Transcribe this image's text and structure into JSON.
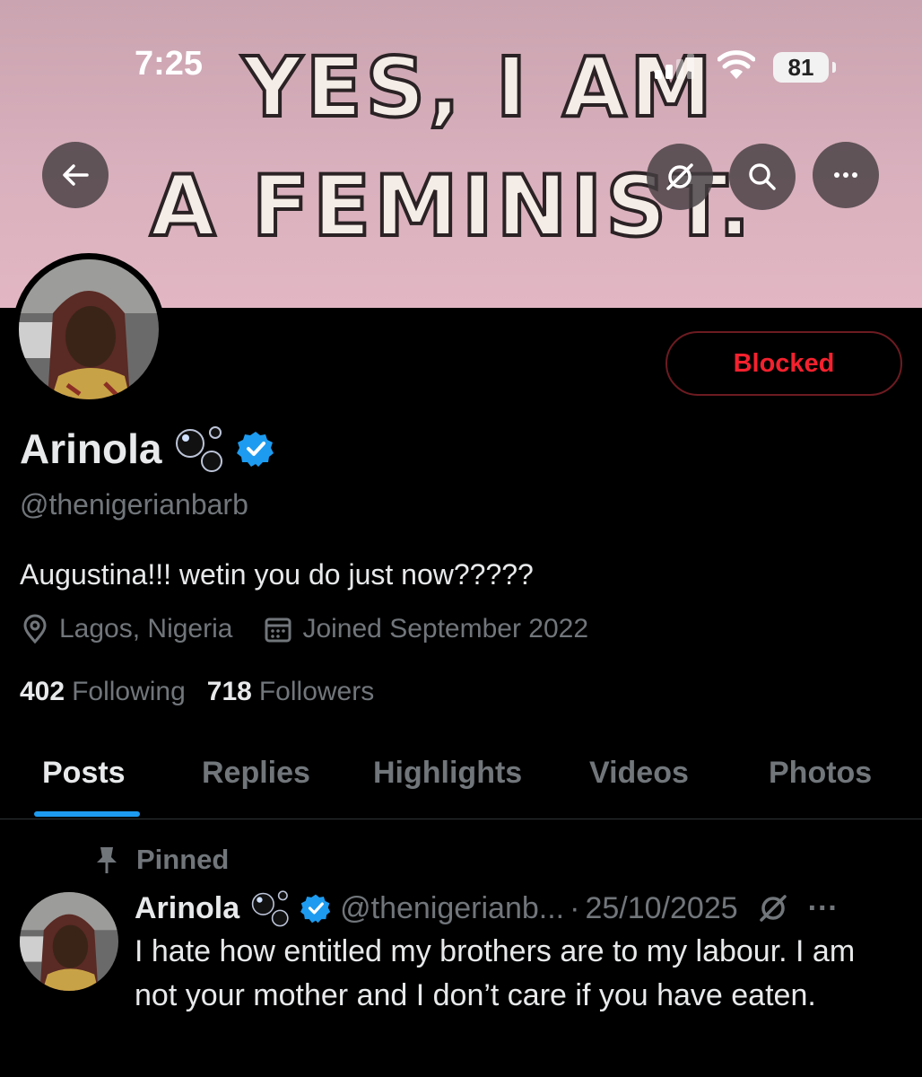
{
  "status_bar": {
    "time": "7:25",
    "battery": "81"
  },
  "banner": {
    "line1": "YES, I AM",
    "line2": "A FEMINIST."
  },
  "nav": {
    "back_icon": "back-arrow-icon",
    "grok_icon": "grok-icon",
    "search_icon": "search-icon",
    "more_icon": "more-icon"
  },
  "profile": {
    "block_label": "Blocked",
    "name": "Arinola",
    "handle": "@thenigerianbarb",
    "bio": "Augustina!!! wetin you do just now?????",
    "location": "Lagos, Nigeria",
    "joined": "Joined September 2022",
    "following_count": "402",
    "following_label": "Following",
    "followers_count": "718",
    "followers_label": "Followers"
  },
  "tabs": [
    {
      "label": "Posts",
      "active": true
    },
    {
      "label": "Replies"
    },
    {
      "label": "Highlights"
    },
    {
      "label": "Videos"
    },
    {
      "label": "Photos"
    }
  ],
  "post": {
    "pinned_label": "Pinned",
    "author": "Arinola",
    "handle": "@thenigerianb...",
    "separator": "·",
    "date": "25/10/2025",
    "more": "···",
    "text": "I hate how entitled my brothers are to my labour. I am not your mother and I don’t care if you have eaten."
  },
  "colors": {
    "accent": "#1d9bf0",
    "blocked": "#f4212e",
    "muted": "#71767b"
  }
}
